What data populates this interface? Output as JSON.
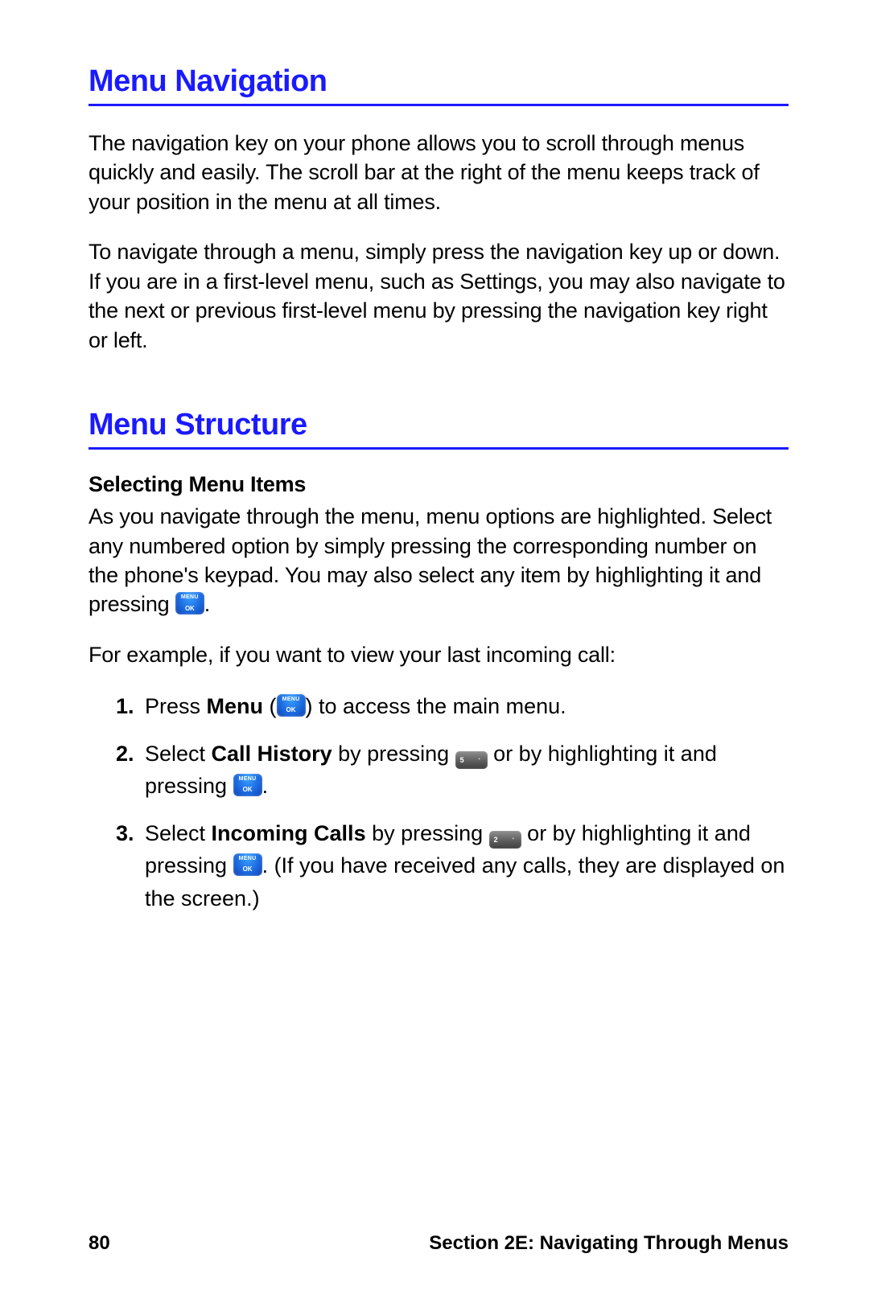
{
  "h1_nav": "Menu Navigation",
  "p_nav1": "The navigation key on your phone allows you to scroll through menus quickly and easily. The scroll bar at the right of the menu keeps track of your position in the menu at all times.",
  "p_nav2": "To navigate through a menu, simply press the navigation key up or down. If you are in a first-level menu, such as Settings, you may also navigate to the next or previous first-level menu by pressing the navigation key right or left.",
  "h1_struct": "Menu Structure",
  "h2_select": "Selecting Menu Items",
  "p_sel1a": "As you navigate through the menu, menu options are highlighted. Select any numbered option by simply pressing the corresponding number on the phone's keypad. You may also select any item by highlighting it and pressing ",
  "p_sel1b": ".",
  "p_sel2": "For example, if you want to view your last incoming call:",
  "step1": {
    "num": "1.",
    "a": "Press ",
    "menu": "Menu",
    "b": " (",
    "c": ") to access the main menu."
  },
  "step2": {
    "num": "2.",
    "a": "Select ",
    "bold": "Call History",
    "b": " by pressing ",
    "key": "5",
    "c": " or by highlighting it and pressing ",
    "d": "."
  },
  "step3": {
    "num": "3.",
    "a": "Select ",
    "bold": "Incoming Calls",
    "b": " by pressing ",
    "key": "2",
    "c": " or by highlighting it and pressing ",
    "d": ". (If you have received any calls, they are displayed on the screen.)"
  },
  "footer_page": "80",
  "footer_section": "Section 2E: Navigating Through Menus"
}
